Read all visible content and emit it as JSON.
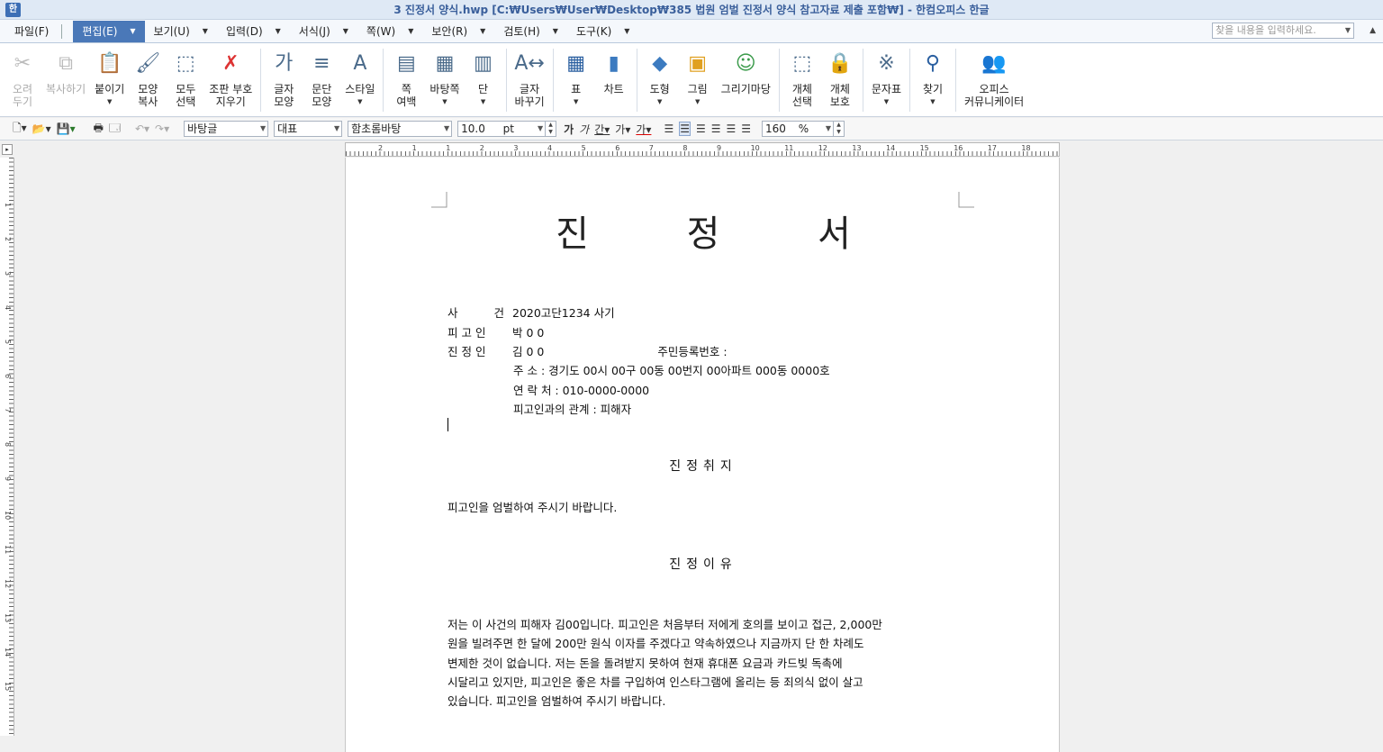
{
  "window": {
    "app_icon": "한",
    "title": "3 진정서 양식.hwp [C:₩Users₩User₩Desktop₩385 법원 엄벌 진정서 양식 참고자료 제출 포함₩] - 한컴오피스 한글"
  },
  "menubar": {
    "items": [
      "파일(F)",
      "편집(E)",
      "보기(U)",
      "입력(D)",
      "서식(J)",
      "쪽(W)",
      "보안(R)",
      "검토(H)",
      "도구(K)"
    ],
    "active": "편집(E)",
    "search_placeholder": "찾을 내용을 입력하세요."
  },
  "ribbon": {
    "buttons": [
      {
        "line1": "오려",
        "line2": "두기",
        "icon": "scissors-icon",
        "disabled": true
      },
      {
        "line1": "복사하기",
        "line2": "",
        "icon": "copy-icon",
        "disabled": true
      },
      {
        "line1": "붙이기",
        "line2": "",
        "icon": "paste-icon",
        "disabled": false
      },
      {
        "line1": "모양",
        "line2": "복사",
        "icon": "format-painter-icon",
        "disabled": false
      },
      {
        "line1": "모두",
        "line2": "선택",
        "icon": "select-all-icon",
        "disabled": false
      },
      {
        "line1": "조판 부호",
        "line2": "지우기",
        "icon": "clear-codes-icon",
        "disabled": false
      },
      {
        "line1": "글자",
        "line2": "모양",
        "icon": "char-shape-icon",
        "disabled": false
      },
      {
        "line1": "문단",
        "line2": "모양",
        "icon": "para-shape-icon",
        "disabled": false
      },
      {
        "line1": "스타일",
        "line2": "",
        "icon": "style-icon",
        "disabled": false
      },
      {
        "line1": "쪽",
        "line2": "여백",
        "icon": "page-margin-icon",
        "disabled": false
      },
      {
        "line1": "바탕쪽",
        "line2": "",
        "icon": "master-page-icon",
        "disabled": false
      },
      {
        "line1": "단",
        "line2": "",
        "icon": "columns-icon",
        "disabled": false
      },
      {
        "line1": "글자",
        "line2": "바꾸기",
        "icon": "replace-char-icon",
        "disabled": false
      },
      {
        "line1": "표",
        "line2": "",
        "icon": "table-icon",
        "disabled": false
      },
      {
        "line1": "차트",
        "line2": "",
        "icon": "chart-icon",
        "disabled": false
      },
      {
        "line1": "도형",
        "line2": "",
        "icon": "shape-icon",
        "disabled": false
      },
      {
        "line1": "그림",
        "line2": "",
        "icon": "picture-icon",
        "disabled": false
      },
      {
        "line1": "그리기마당",
        "line2": "",
        "icon": "clipart-icon",
        "disabled": false
      },
      {
        "line1": "개체",
        "line2": "선택",
        "icon": "object-select-icon",
        "disabled": false
      },
      {
        "line1": "개체",
        "line2": "보호",
        "icon": "object-protect-icon",
        "disabled": false
      },
      {
        "line1": "문자표",
        "line2": "",
        "icon": "symbol-icon",
        "disabled": false
      },
      {
        "line1": "찾기",
        "line2": "",
        "icon": "find-icon",
        "disabled": false
      },
      {
        "line1": "오피스",
        "line2": "커뮤니케이터",
        "icon": "communicator-icon",
        "disabled": false
      }
    ]
  },
  "formatbar": {
    "style": "바탕글",
    "lang": "대표",
    "font": "함초롬바탕",
    "size": "10.0",
    "unit": "pt",
    "line_spacing": "160",
    "percent": "%"
  },
  "document": {
    "title": "진 정 서",
    "fields": [
      {
        "label": "사 건",
        "value": "2020고단1234 사기"
      },
      {
        "label": "피고인",
        "value": "박 0 0"
      },
      {
        "label": "진정인",
        "value": "김 0 0",
        "extra": "주민등록번호 :"
      }
    ],
    "sub_fields": [
      "주      소 : 경기도 00시 00구 00동 00번지 00아파트 000동 0000호",
      "연 락 처 : 010-0000-0000",
      "피고인과의 관계 : 피해자"
    ],
    "heading1": "진정취지",
    "purpose": "피고인을 엄벌하여 주시기 바랍니다.",
    "heading2": "진정이유",
    "reason_lines": [
      " 저는 이 사건의 피해자 김00입니다. 피고인은 처음부터 저에게 호의를 보이고 접근, 2,000만",
      "원을 빌려주면 한 달에 200만 원식 이자를 주겠다고 약속하였으나 지금까지 단 한 차례도",
      "변제한 것이 없습니다. 저는 돈을 돌려받지 못하여 현재 휴대폰 요금과 카드빚 독촉에",
      "시달리고 있지만, 피고인은 좋은 차를 구입하여 인스타그램에 올리는 등 죄의식 없이 살고",
      "있습니다. 피고인을 엄벌하여 주시기 바랍니다."
    ]
  },
  "ruler": {
    "h_labels": [
      "2",
      "1",
      "1",
      "2",
      "3",
      "4",
      "5",
      "6",
      "7",
      "8",
      "9",
      "10",
      "11",
      "12",
      "13",
      "14",
      "15",
      "16",
      "17",
      "18"
    ],
    "v_labels": [
      "1",
      "2",
      "3",
      "4",
      "5",
      "6",
      "7",
      "8",
      "9",
      "10",
      "11",
      "12",
      "13",
      "14",
      "15"
    ]
  }
}
